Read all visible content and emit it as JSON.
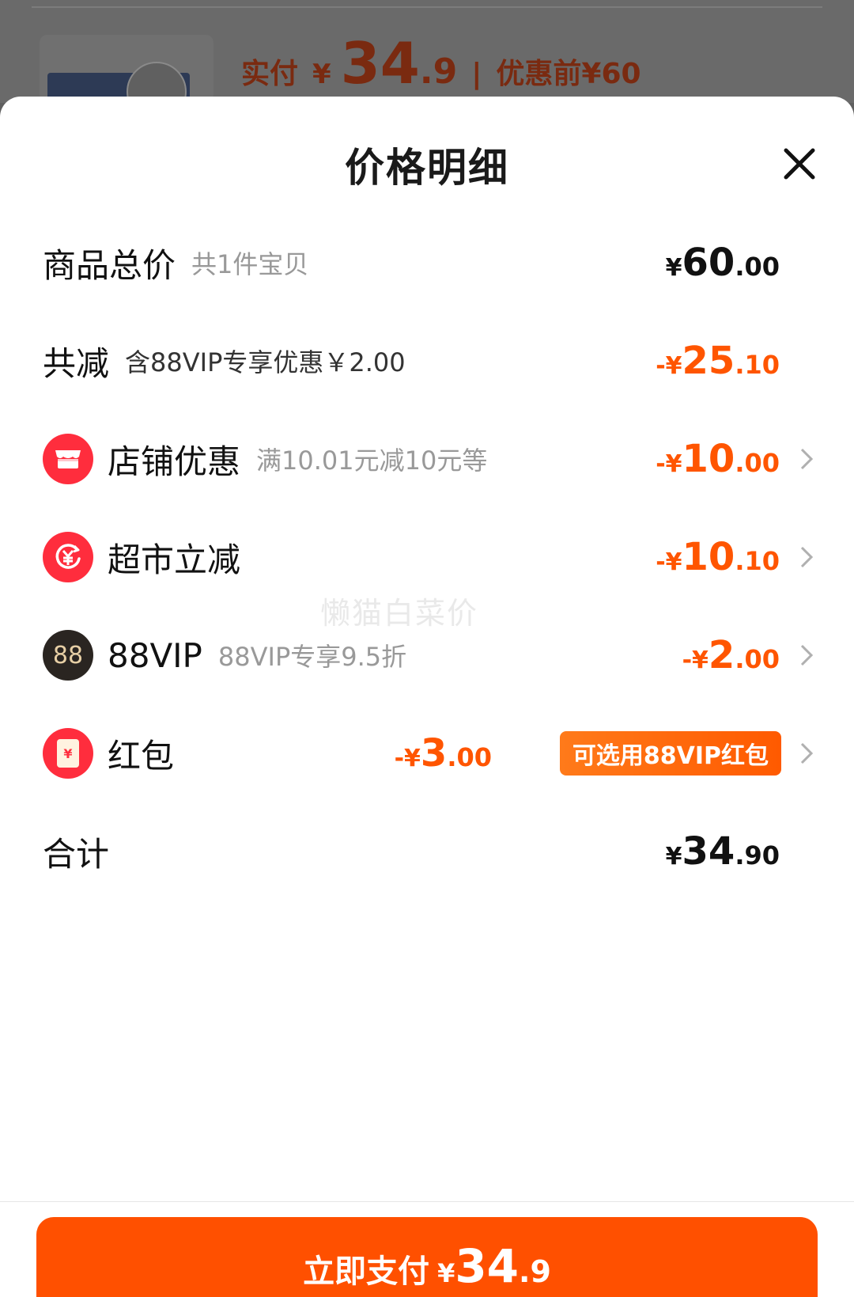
{
  "background": {
    "paid_label": "实付",
    "currency": "¥",
    "paid_int": "34",
    "paid_dec": ".9",
    "separator": "|",
    "original": "优惠前¥60"
  },
  "sheet": {
    "title": "价格明细"
  },
  "rows": {
    "total": {
      "name": "商品总价",
      "note": "共1件宝贝",
      "sym": "¥",
      "int": "60",
      "dec": ".00"
    },
    "discount": {
      "name": "共减",
      "note": "含88VIP专享优惠￥2.00",
      "sym": "-¥",
      "int": "25",
      "dec": ".10"
    },
    "store": {
      "name": "店铺优惠",
      "note": "满10.01元减10元等",
      "sym": "-¥",
      "int": "10",
      "dec": ".00"
    },
    "market": {
      "name": "超市立减",
      "sym": "-¥",
      "int": "10",
      "dec": ".10"
    },
    "vip": {
      "icon_text": "88",
      "name": "88VIP",
      "note": "88VIP专享9.5折",
      "sym": "-¥",
      "int": "2",
      "dec": ".00"
    },
    "redbag": {
      "name": "红包",
      "sym": "-¥",
      "int": "3",
      "dec": ".00",
      "badge": "可选用88VIP红包",
      "icon_text": "¥"
    },
    "sum": {
      "name": "合计",
      "sym": "¥",
      "int": "34",
      "dec": ".90"
    }
  },
  "watermark": "懒猫白菜价",
  "pay_button": {
    "label": "立即支付",
    "sym": "¥",
    "int": "34",
    "dec": ".9"
  },
  "colors": {
    "accent": "#ff5000",
    "discount": "#ff5500",
    "icon_red": "#ff2d3d",
    "vip_dark": "#2a2521"
  },
  "icons": [
    "close-icon",
    "store-icon",
    "yuan-refund-icon",
    "vip-88-icon",
    "red-packet-icon",
    "chevron-right-icon"
  ]
}
